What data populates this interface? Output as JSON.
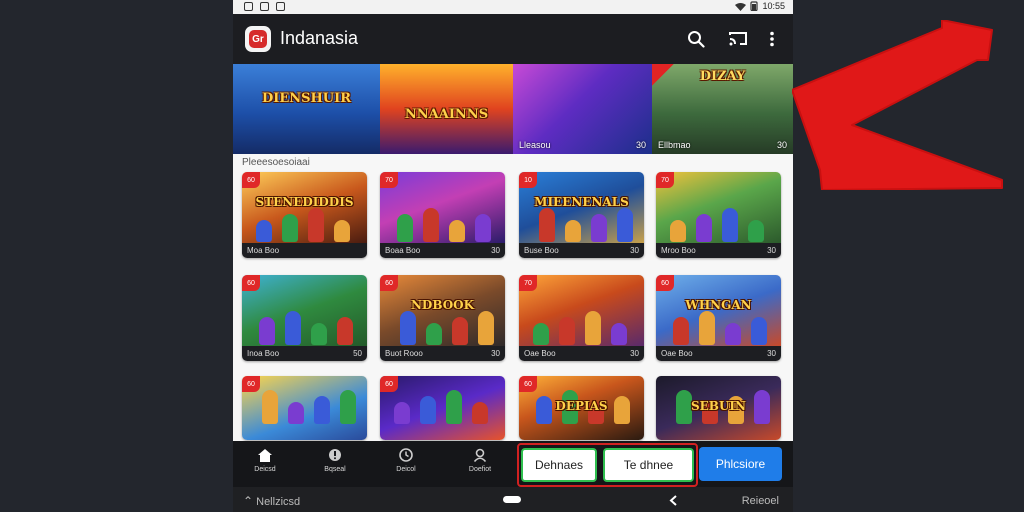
{
  "statusbar": {
    "time": "10:55"
  },
  "appbar": {
    "title": "Indanasia",
    "logo_text": "Gr"
  },
  "banner": [
    {
      "title": "DIENSHUIR",
      "subtitle": "",
      "caption_left": "",
      "caption_right": "",
      "bg": "linear-gradient(180deg,#3b7fd8 0%,#1d4fa8 55%,#142b66 100%)",
      "has_tag": false
    },
    {
      "title": "NNAAINNS",
      "subtitle": "",
      "caption_left": "",
      "caption_right": "",
      "bg": "linear-gradient(180deg,#ffb12b 0%,#e0431f 50%,#3a1a6e 100%)",
      "has_tag": false
    },
    {
      "title": "",
      "subtitle": "",
      "caption_left": "Lleasou",
      "caption_right": "30",
      "bg": "linear-gradient(135deg,#c74ad6 0%,#5e2cc2 45%,#1c2f8a 100%)",
      "has_tag": false
    },
    {
      "title": "DIZAY",
      "subtitle": "",
      "caption_left": "Ellbmao",
      "caption_right": "30",
      "bg": "linear-gradient(180deg,#7fa86a 0%,#3d6a3d 55%,#263b26 100%)",
      "has_tag": true
    }
  ],
  "section_label": "Pleeesoesoiaai",
  "cards": [
    {
      "title": "STENEDIDDIS",
      "foot_left": "Moa Boo",
      "foot_right": "",
      "badge": "60",
      "bg": "linear-gradient(160deg,#ffce5a 0%,#c8581c 50%,#4a1c10 100%)"
    },
    {
      "title": "",
      "foot_left": "Boaa Boo",
      "foot_right": "30",
      "badge": "70",
      "bg": "linear-gradient(160deg,#7a3cd8 0%,#c33fb4 45%,#2b1c6a 100%)"
    },
    {
      "title": "MIEENENALS",
      "foot_left": "Buse Boo",
      "foot_right": "30",
      "badge": "10",
      "bg": "linear-gradient(160deg,#2a7fd8 0%,#1f4e9a 50%,#c8a04a 100%)"
    },
    {
      "title": "",
      "foot_left": "Mroo Boo",
      "foot_right": "30",
      "badge": "70",
      "bg": "linear-gradient(160deg,#f3c23c 0%,#5aa64a 45%,#2c5a2c 100%)"
    },
    {
      "title": "",
      "foot_left": "Inoa Boo",
      "foot_right": "50",
      "badge": "60",
      "bg": "linear-gradient(160deg,#3fb1d4 0%,#2f8a3f 50%,#245a2a 100%)"
    },
    {
      "title": "NDBOOK",
      "foot_left": "Buot Rooo",
      "foot_right": "30",
      "badge": "60",
      "bg": "linear-gradient(160deg,#e88a3a 0%,#7a4a2a 50%,#2f2a2a 100%)"
    },
    {
      "title": "",
      "foot_left": "Oae Boo",
      "foot_right": "30",
      "badge": "70",
      "bg": "linear-gradient(160deg,#ffa63a 0%,#c84a1c 45%,#5a2a6a 100%)"
    },
    {
      "title": "WHNGAN",
      "foot_left": "Oae Boo",
      "foot_right": "30",
      "badge": "60",
      "bg": "linear-gradient(160deg,#6fb0ea 0%,#3b6ac8 50%,#c84a2a 100%)"
    },
    {
      "title": "",
      "foot_left": "",
      "foot_right": "",
      "badge": "60",
      "bg": "linear-gradient(160deg,#ffd64a 0%,#3b8ad8 60%,#2a4a9a 100%)"
    },
    {
      "title": "",
      "foot_left": "",
      "foot_right": "",
      "badge": "60",
      "bg": "linear-gradient(160deg,#2a1a6a 0%,#5a2ac8 50%,#e8532a 100%)"
    },
    {
      "title": "DEPIAS",
      "foot_left": "",
      "foot_right": "",
      "badge": "60",
      "bg": "linear-gradient(160deg,#ffb23a 0%,#c8561c 40%,#2a1a10 100%)"
    },
    {
      "title": "SEBUIN",
      "foot_left": "",
      "foot_right": "",
      "badge": "",
      "bg": "linear-gradient(160deg,#1c1a2a 0%,#3a2a5a 50%,#c84a2a 100%)"
    }
  ],
  "bottomnav": {
    "items": [
      {
        "label": "Deicsd",
        "icon": "home-icon"
      },
      {
        "label": "Bqseal",
        "icon": "info-icon"
      },
      {
        "label": "Deicol",
        "icon": "clock-icon"
      },
      {
        "label": "Doefiot",
        "icon": "profile-icon"
      }
    ],
    "buttons": {
      "left": "Dehnaes",
      "middle": "Te dhnee",
      "primary": "Phlcsiore"
    }
  },
  "sysnav": {
    "left_label": "Nellzicsd",
    "right_label": "Reieoel"
  },
  "colors": {
    "accent_red": "#d12121",
    "primary_blue": "#1f7de9",
    "outline_green": "#2fbf4f"
  }
}
